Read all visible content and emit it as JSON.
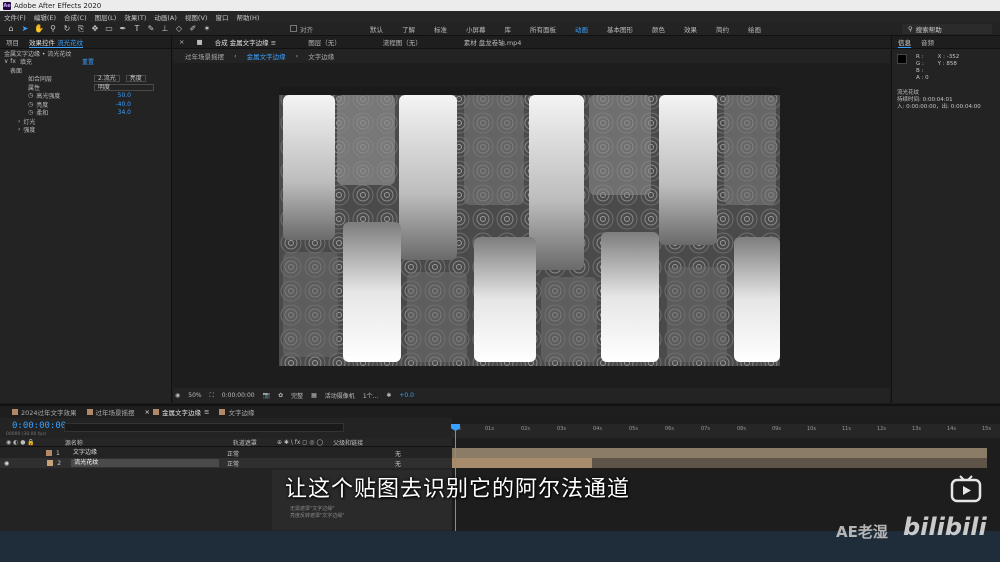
{
  "app": {
    "title": "Adobe After Effects 2020"
  },
  "menu": [
    "文件(F)",
    "编辑(E)",
    "合成(C)",
    "图层(L)",
    "效果(T)",
    "动画(A)",
    "视图(V)",
    "窗口",
    "帮助(H)"
  ],
  "toolbar": {
    "snap_label": "对齐",
    "workspaces": [
      "默认",
      "了解",
      "标准",
      "小屏幕",
      "库",
      "所有面板",
      "动画",
      "基本图形",
      "颜色",
      "效果",
      "简约",
      "绘画"
    ],
    "active_workspace": "动画",
    "search_help": "搜索帮助"
  },
  "left_panel": {
    "tabs": [
      "项目",
      "效果控件",
      "流光花纹"
    ],
    "breadcrumb": "金属文字边缘 • 流光花纹",
    "effect_name": "填充",
    "effect_reset": "重置",
    "rows": [
      {
        "label": "表面",
        "value": ""
      },
      {
        "label": "如合同层",
        "value": ""
      },
      {
        "label": "属性",
        "value": ""
      },
      {
        "label": "高光强度",
        "value": "50.0"
      },
      {
        "label": "亮度",
        "value": "-40.0"
      },
      {
        "label": "柔和",
        "value": "34.0"
      },
      {
        "label": "灯光",
        "value": ""
      },
      {
        "label": "强度",
        "value": ""
      }
    ],
    "dropdown1": "2.流光",
    "dropdown2": "亮度",
    "dropdown3": "明度"
  },
  "comp_tabs": [
    "合成 金属文字边缘",
    "图层（无）",
    "流程图（无）",
    "素材 盘龙卷轴.mp4"
  ],
  "breadcrumbs": [
    "过年场景摇摆",
    "金属文字边缘",
    "文字边缘"
  ],
  "viewer_footer": {
    "zoom": "50%",
    "timecode": "0:00:00:00",
    "resolution": "完整",
    "camera": "活动摄像机",
    "views": "1个...",
    "exposure": "+0.0"
  },
  "right_panel": {
    "tabs": [
      "信息",
      "音频"
    ],
    "r": "R :",
    "g": "G :",
    "b": "B :",
    "a": "A : 0",
    "x": "X : -352",
    "y": "Y : 858",
    "layer_name": "流光花纹",
    "duration": "持续时间: 0:00:04:01",
    "in_out": "入: 0:00:00:00，出: 0:00:04:00"
  },
  "timeline": {
    "tabs": [
      "2024过年文字效果",
      "过年场景摇摆",
      "金属文字边缘",
      "文字边缘"
    ],
    "active_tab": "金属文字边缘",
    "timecode": "0:00:00:00",
    "timecode_sub": "00000 (30.00 fps)",
    "header": {
      "name": "源名称",
      "mode": "轨道遮罩",
      "parent": "父级和链接"
    },
    "ruler": [
      "0s",
      "01s",
      "02s",
      "03s",
      "04s",
      "05s",
      "06s",
      "07s",
      "08s",
      "09s",
      "10s",
      "11s",
      "12s",
      "13s",
      "14s",
      "15s"
    ],
    "layers": [
      {
        "num": "1",
        "name": "文字边缘",
        "mode": "正常",
        "parent": "无",
        "color": "#b08a68"
      },
      {
        "num": "2",
        "name": "流光花纹",
        "mode": "正常",
        "parent": "无",
        "color": "#c8a27a"
      }
    ],
    "tooltip_lines": [
      "无需遮罩\"文字边缘\"",
      "亮度反转遮罩\"文字边缘\""
    ]
  },
  "subtitle": "让这个贴图去识别它的阿尔法通道",
  "watermark": "AE老湿",
  "bili": "bilibili"
}
